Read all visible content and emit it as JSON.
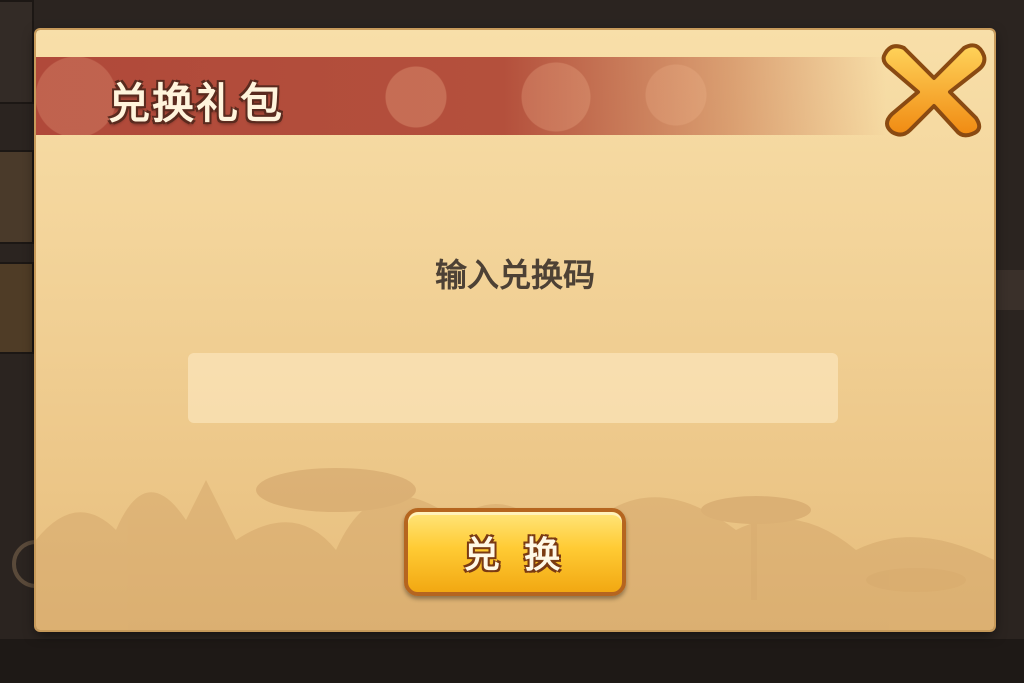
{
  "dialog": {
    "title": "兑换礼包",
    "prompt": "输入兑换码",
    "code_input": {
      "value": "",
      "placeholder": ""
    },
    "redeem_label": "兑 换"
  },
  "icons": {
    "close": "close-x-icon"
  },
  "colors": {
    "ribbon": "#b0493a",
    "panel": "#f3d49a",
    "button": "#ffcb34",
    "close": "#f5a623"
  }
}
